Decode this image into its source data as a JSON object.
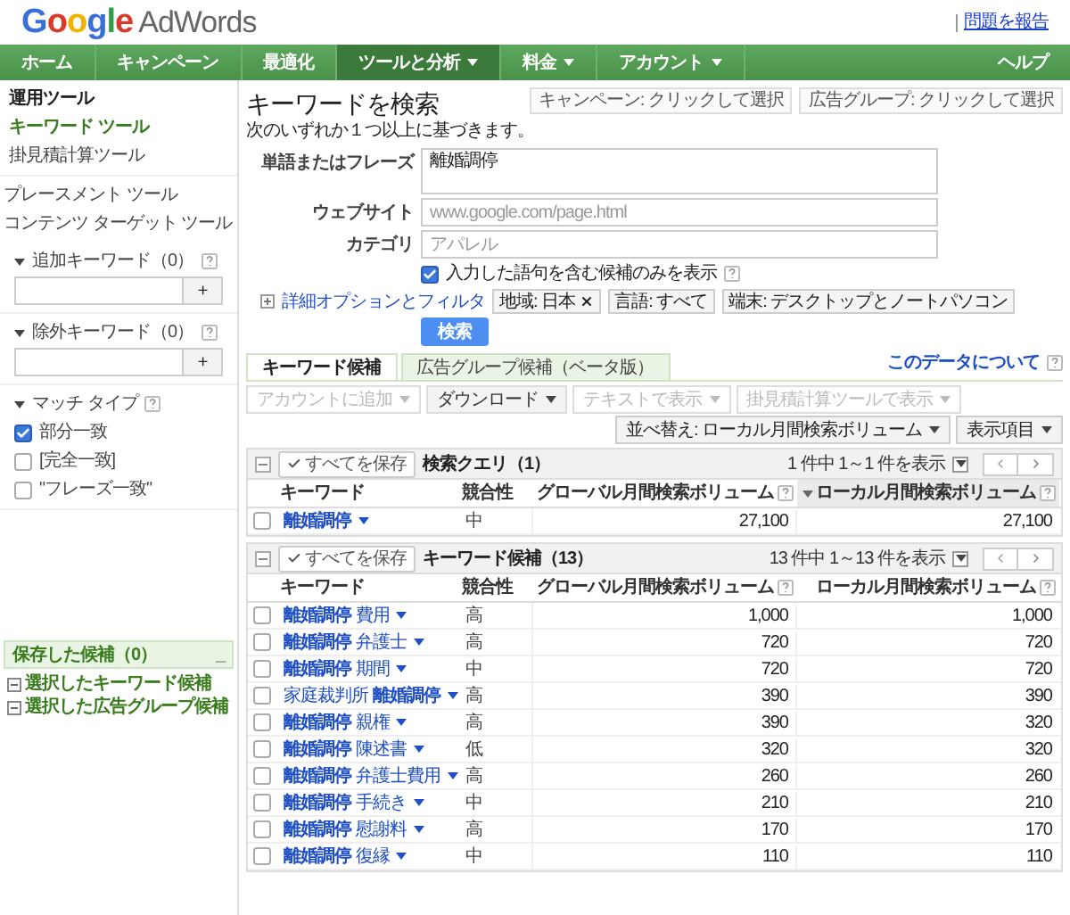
{
  "header": {
    "logo": {
      "brand": "Google",
      "product": "AdWords"
    },
    "report_link": "問題を報告"
  },
  "nav": {
    "items": [
      {
        "label": "ホーム",
        "dropdown": false,
        "selected": false
      },
      {
        "label": "キャンペーン",
        "dropdown": false,
        "selected": false
      },
      {
        "label": "最適化",
        "dropdown": false,
        "selected": false
      },
      {
        "label": "ツールと分析",
        "dropdown": true,
        "selected": true
      },
      {
        "label": "料金",
        "dropdown": true,
        "selected": false
      },
      {
        "label": "アカウント",
        "dropdown": true,
        "selected": false
      }
    ],
    "help": "ヘルプ"
  },
  "sidebar": {
    "heading": "運用ツール",
    "tools": [
      {
        "label": "キーワード ツール",
        "selected": true
      },
      {
        "label": "掛見積計算ツール",
        "selected": false
      }
    ],
    "placement_tools": [
      {
        "label": "プレースメント ツール",
        "selected": false
      },
      {
        "label": "コンテンツ ターゲット ツール",
        "selected": false
      }
    ],
    "keyword_boxes": [
      {
        "title": "追加キーワード（0）",
        "button": "+"
      },
      {
        "title": "除外キーワード（0）",
        "button": "+"
      }
    ],
    "match_type": {
      "title": "マッチ タイプ",
      "options": [
        {
          "label": "部分一致",
          "checked": true
        },
        {
          "label": "[完全一致]",
          "checked": false
        },
        {
          "label": "\"フレーズ一致\"",
          "checked": false
        }
      ]
    },
    "saved": {
      "title": "保存した候補（0）",
      "collapse": "_",
      "items": [
        "選択したキーワード候補",
        "選択した広告グループ候補"
      ]
    }
  },
  "main": {
    "title": "キーワードを検索",
    "subtitle": "次のいずれか１つ以上に基づきます。",
    "selectors": [
      "キャンペーン: クリックして選択",
      "広告グループ: クリックして選択"
    ],
    "fields": [
      {
        "kind": "textarea",
        "label": "単語またはフレーズ",
        "value": "離婚調停"
      },
      {
        "kind": "text",
        "label": "ウェブサイト",
        "placeholder": "www.google.com/page.html"
      },
      {
        "kind": "text",
        "label": "カテゴリ",
        "placeholder": "アパレル"
      }
    ],
    "only_matching": {
      "label": "入力した語句を含む候補のみを表示",
      "checked": true
    },
    "advanced_link": "詳細オプションとフィルタ",
    "filters": [
      {
        "label": "地域: 日本",
        "removable": true
      },
      {
        "label": "言語: すべて",
        "removable": false
      },
      {
        "label": "端末: デスクトップとノートパソコン",
        "removable": false
      }
    ],
    "search_button": "検索",
    "tabs": [
      {
        "label": "キーワード候補",
        "selected": true
      },
      {
        "label": "広告グループ候補（ベータ版）",
        "selected": false
      }
    ],
    "about_link": "このデータについて",
    "toolbar": [
      {
        "label": "アカウントに追加",
        "disabled": true
      },
      {
        "label": "ダウンロード",
        "disabled": false
      },
      {
        "label": "テキストで表示",
        "disabled": true
      },
      {
        "label": "掛見積計算ツールで表示",
        "disabled": true
      }
    ],
    "sort_button": "並べ替え: ローカル月間検索ボリューム",
    "columns_button": "表示項目",
    "tables": [
      {
        "save_all": "すべてを保存",
        "title": "検索クエリ（1）",
        "range": "1 件中 1～1 件を表示",
        "columns": [
          {
            "label": "キーワード",
            "help": false,
            "sorted": false
          },
          {
            "label": "競合性",
            "help": false,
            "sorted": false
          },
          {
            "label": "グローバル月間検索ボリューム",
            "help": true,
            "sorted": false
          },
          {
            "label": "ローカル月間検索ボリューム",
            "help": true,
            "sorted": true
          }
        ],
        "rows": [
          {
            "checked": false,
            "keyword": "**離婚調停**",
            "competition": "中",
            "global": "27,100",
            "local": "27,100"
          }
        ]
      },
      {
        "save_all": "すべてを保存",
        "title": "キーワード候補（13）",
        "range": "13 件中 1～13 件を表示",
        "columns": [
          {
            "label": "キーワード",
            "help": false,
            "sorted": false
          },
          {
            "label": "競合性",
            "help": false,
            "sorted": false
          },
          {
            "label": "グローバル月間検索ボリューム",
            "help": true,
            "sorted": false
          },
          {
            "label": "ローカル月間検索ボリューム",
            "help": true,
            "sorted": false
          }
        ],
        "rows": [
          {
            "checked": false,
            "keyword": "**離婚調停** 費用",
            "competition": "高",
            "global": "1,000",
            "local": "1,000"
          },
          {
            "checked": false,
            "keyword": "**離婚調停** 弁護士",
            "competition": "高",
            "global": "720",
            "local": "720"
          },
          {
            "checked": false,
            "keyword": "**離婚調停** 期間",
            "competition": "中",
            "global": "720",
            "local": "720"
          },
          {
            "checked": false,
            "keyword": "家庭裁判所 **離婚調停**",
            "competition": "高",
            "global": "390",
            "local": "390"
          },
          {
            "checked": false,
            "keyword": "**離婚調停** 親権",
            "competition": "高",
            "global": "390",
            "local": "320"
          },
          {
            "checked": false,
            "keyword": "**離婚調停** 陳述書",
            "competition": "低",
            "global": "320",
            "local": "320"
          },
          {
            "checked": false,
            "keyword": "**離婚調停** 弁護士費用",
            "competition": "高",
            "global": "260",
            "local": "260"
          },
          {
            "checked": false,
            "keyword": "**離婚調停** 手続き",
            "competition": "中",
            "global": "210",
            "local": "210"
          },
          {
            "checked": false,
            "keyword": "**離婚調停** 慰謝料",
            "competition": "高",
            "global": "170",
            "local": "170"
          },
          {
            "checked": false,
            "keyword": "**離婚調停** 復縁",
            "competition": "中",
            "global": "110",
            "local": "110"
          }
        ]
      }
    ]
  }
}
